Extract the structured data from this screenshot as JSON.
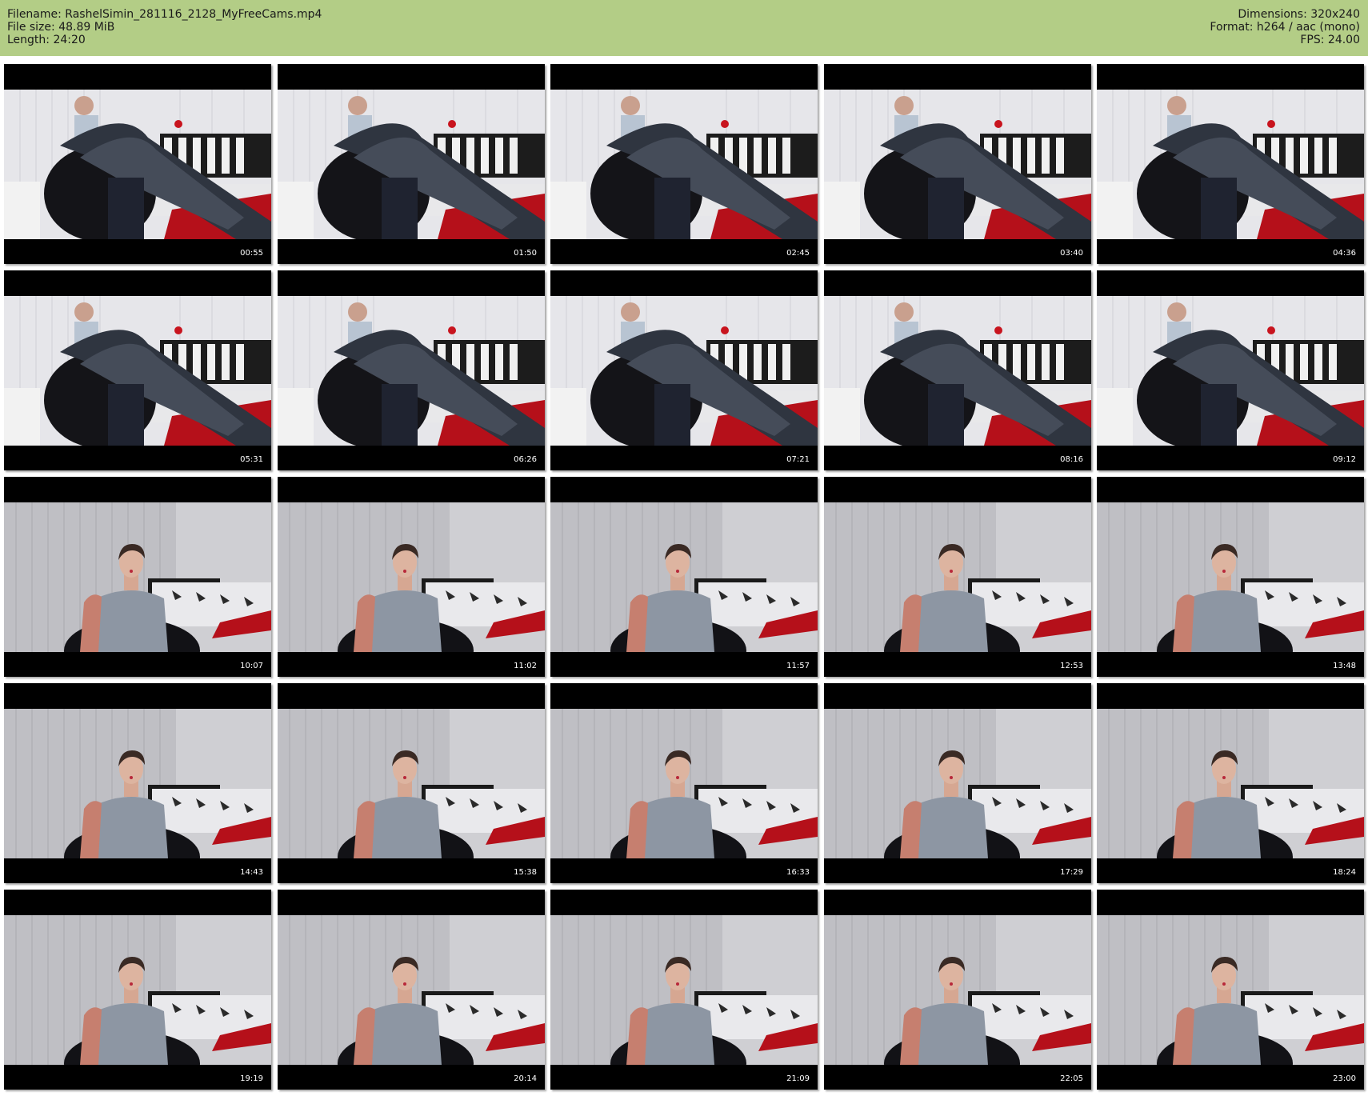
{
  "meta": {
    "filename": "Filename: RashelSimin_281116_2128_MyFreeCams.mp4",
    "filesize": "File size: 48.89 MiB",
    "length": "Length: 24:20",
    "dimensions": "Dimensions: 320x240",
    "format": "Format: h264 / aac (mono)",
    "fps": "FPS: 24.00"
  },
  "colors": {
    "header_bg": "#b3cd86",
    "timestamp": "#ffffff"
  },
  "thumbnails": [
    {
      "time": "00:55",
      "scene": "boots"
    },
    {
      "time": "01:50",
      "scene": "boots"
    },
    {
      "time": "02:45",
      "scene": "boots"
    },
    {
      "time": "03:40",
      "scene": "boots"
    },
    {
      "time": "04:36",
      "scene": "boots"
    },
    {
      "time": "05:31",
      "scene": "boots"
    },
    {
      "time": "06:26",
      "scene": "boots"
    },
    {
      "time": "07:21",
      "scene": "boots"
    },
    {
      "time": "08:16",
      "scene": "boots"
    },
    {
      "time": "09:12",
      "scene": "boots"
    },
    {
      "time": "10:07",
      "scene": "seated"
    },
    {
      "time": "11:02",
      "scene": "seated"
    },
    {
      "time": "11:57",
      "scene": "seated"
    },
    {
      "time": "12:53",
      "scene": "seated"
    },
    {
      "time": "13:48",
      "scene": "seated"
    },
    {
      "time": "14:43",
      "scene": "seated"
    },
    {
      "time": "15:38",
      "scene": "seated"
    },
    {
      "time": "16:33",
      "scene": "seated"
    },
    {
      "time": "17:29",
      "scene": "seated"
    },
    {
      "time": "18:24",
      "scene": "seated"
    },
    {
      "time": "19:19",
      "scene": "seated"
    },
    {
      "time": "20:14",
      "scene": "seated"
    },
    {
      "time": "21:09",
      "scene": "seated"
    },
    {
      "time": "22:05",
      "scene": "seated"
    },
    {
      "time": "23:00",
      "scene": "seated"
    }
  ]
}
